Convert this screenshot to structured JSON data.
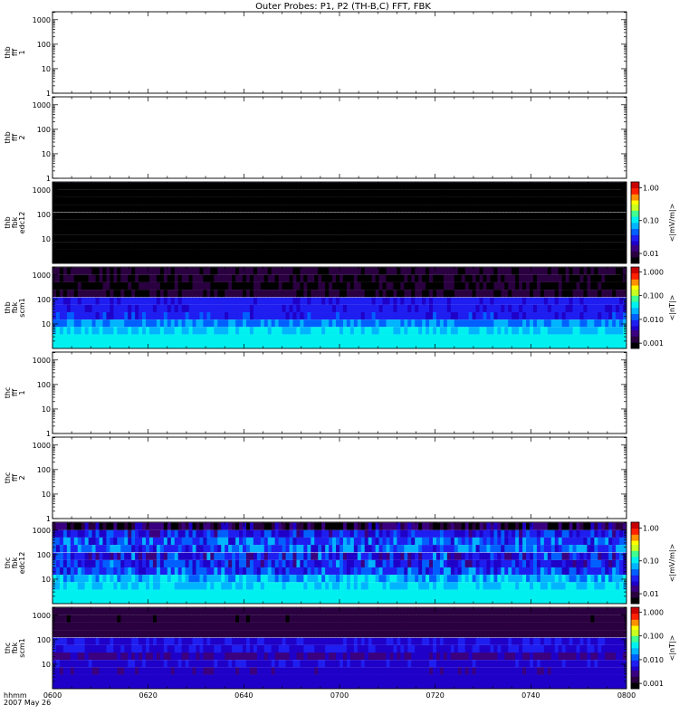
{
  "chart_data": {
    "type": "heatmap",
    "title": "Outer Probes: P1, P2 (TH-B,C) FFT, FBK",
    "x_axis": {
      "label_lines": [
        "hhmm",
        "2007 May 26"
      ],
      "range": [
        "0600",
        "0800"
      ],
      "tick_labels": [
        "0600",
        "0620",
        "0640",
        "0700",
        "0720",
        "0740",
        "0800"
      ]
    },
    "y_axis": {
      "scale": "log",
      "ticks": [
        1,
        10,
        100,
        1000
      ],
      "tick_labels": [
        "1",
        "10",
        "100",
        "1000"
      ],
      "fbk_ticks": [
        10,
        100,
        1000
      ],
      "fbk_tick_labels": [
        "10",
        "100",
        "1000"
      ]
    },
    "colormap": [
      "#000000",
      "#2a0040",
      "#3a0080",
      "#1e00c8",
      "#1e1ef0",
      "#0060ff",
      "#00b4ff",
      "#00f0f0",
      "#40ff90",
      "#c8ff20",
      "#ffff00",
      "#ff9000",
      "#ff2000",
      "#c80000"
    ],
    "panels": [
      {
        "id": "thb-ffp1",
        "ylabel_lines": [
          "thb",
          "fff",
          "1"
        ],
        "has_data": false
      },
      {
        "id": "thb-ffp2",
        "ylabel_lines": [
          "thb",
          "fff",
          "2"
        ],
        "has_data": false
      },
      {
        "id": "thb-fbk-edc12",
        "ylabel_lines": [
          "thb",
          "fbk",
          "edc12"
        ],
        "has_data": true,
        "colorbar": {
          "label": "<|mV/m|>",
          "tick_labels": [
            "1.00",
            "0.10",
            "0.01"
          ],
          "range": [
            0.005,
            1.5
          ]
        },
        "bands": [
          {
            "freq": 2048,
            "level": 0.28,
            "var": 0.0
          },
          {
            "freq": 1000,
            "level": 0.0,
            "var": 0.0
          },
          {
            "freq": 500,
            "level": 0.0,
            "var": 0.0
          },
          {
            "freq": 250,
            "level": 0.0,
            "var": 0.0
          },
          {
            "freq": 125,
            "level": 0.0,
            "var": 0.0
          },
          {
            "freq": 60,
            "level": 0.0,
            "var": 0.0
          },
          {
            "freq": 30,
            "level": 0.0,
            "var": 0.0
          },
          {
            "freq": 15,
            "level": 0.0,
            "var": 0.0
          },
          {
            "freq": 7.5,
            "level": 0.0,
            "var": 0.0
          },
          {
            "freq": 3.75,
            "level": 0.0,
            "var": 0.0
          }
        ]
      },
      {
        "id": "thb-fbk-scm1",
        "ylabel_lines": [
          "thb",
          "fbk",
          "scm1"
        ],
        "has_data": true,
        "colorbar": {
          "label": "<|nT|>",
          "tick_labels": [
            "1.000",
            "0.100",
            "0.010",
            "0.001"
          ],
          "range": [
            0.0006,
            1.6
          ]
        },
        "bands": [
          {
            "freq": 2048,
            "level": 0.28,
            "var": 0.01
          },
          {
            "freq": 1000,
            "level": 0.08,
            "var": 0.02
          },
          {
            "freq": 500,
            "level": 0.07,
            "var": 0.03
          },
          {
            "freq": 250,
            "level": 0.06,
            "var": 0.03
          },
          {
            "freq": 125,
            "level": 0.08,
            "var": 0.03
          },
          {
            "freq": 60,
            "level": 0.3,
            "var": 0.03
          },
          {
            "freq": 30,
            "level": 0.3,
            "var": 0.03
          },
          {
            "freq": 15,
            "level": 0.32,
            "var": 0.05
          },
          {
            "freq": 7.5,
            "level": 0.42,
            "var": 0.05
          },
          {
            "freq": 3.75,
            "level": 0.5,
            "var": 0.06
          }
        ]
      },
      {
        "id": "thc-ffp1",
        "ylabel_lines": [
          "thc",
          "fff",
          "1"
        ],
        "has_data": false
      },
      {
        "id": "thc-ffp2",
        "ylabel_lines": [
          "thc",
          "fff",
          "2"
        ],
        "has_data": false
      },
      {
        "id": "thc-fbk-edc12",
        "ylabel_lines": [
          "thc",
          "fbk",
          "edc12"
        ],
        "has_data": true,
        "colorbar": {
          "label": "<|mV/m|>",
          "tick_labels": [
            "1.00",
            "0.10",
            "0.01"
          ],
          "range": [
            0.005,
            1.5
          ]
        },
        "bands": [
          {
            "freq": 2048,
            "level": 0.33,
            "var": 0.1
          },
          {
            "freq": 1000,
            "level": 0.12,
            "var": 0.12
          },
          {
            "freq": 500,
            "level": 0.3,
            "var": 0.1
          },
          {
            "freq": 250,
            "level": 0.38,
            "var": 0.12
          },
          {
            "freq": 125,
            "level": 0.38,
            "var": 0.12
          },
          {
            "freq": 60,
            "level": 0.3,
            "var": 0.14
          },
          {
            "freq": 30,
            "level": 0.32,
            "var": 0.12
          },
          {
            "freq": 15,
            "level": 0.36,
            "var": 0.1
          },
          {
            "freq": 7.5,
            "level": 0.46,
            "var": 0.08
          },
          {
            "freq": 3.75,
            "level": 0.5,
            "var": 0.06
          }
        ]
      },
      {
        "id": "thc-fbk-scm1",
        "ylabel_lines": [
          "thc",
          "fbk",
          "scm1"
        ],
        "has_data": true,
        "colorbar": {
          "label": "<|nT|>",
          "tick_labels": [
            "1.000",
            "0.100",
            "0.010",
            "0.001"
          ],
          "range": [
            0.0006,
            1.6
          ]
        },
        "bands": [
          {
            "freq": 2048,
            "level": 0.28,
            "var": 0.01
          },
          {
            "freq": 1000,
            "level": 0.1,
            "var": 0.02
          },
          {
            "freq": 500,
            "level": 0.09,
            "var": 0.02
          },
          {
            "freq": 250,
            "level": 0.1,
            "var": 0.02
          },
          {
            "freq": 125,
            "level": 0.12,
            "var": 0.02
          },
          {
            "freq": 60,
            "level": 0.28,
            "var": 0.03
          },
          {
            "freq": 30,
            "level": 0.28,
            "var": 0.03
          },
          {
            "freq": 15,
            "level": 0.2,
            "var": 0.04
          },
          {
            "freq": 7.5,
            "level": 0.26,
            "var": 0.04
          },
          {
            "freq": 3.75,
            "level": 0.24,
            "var": 0.04
          }
        ]
      }
    ]
  }
}
